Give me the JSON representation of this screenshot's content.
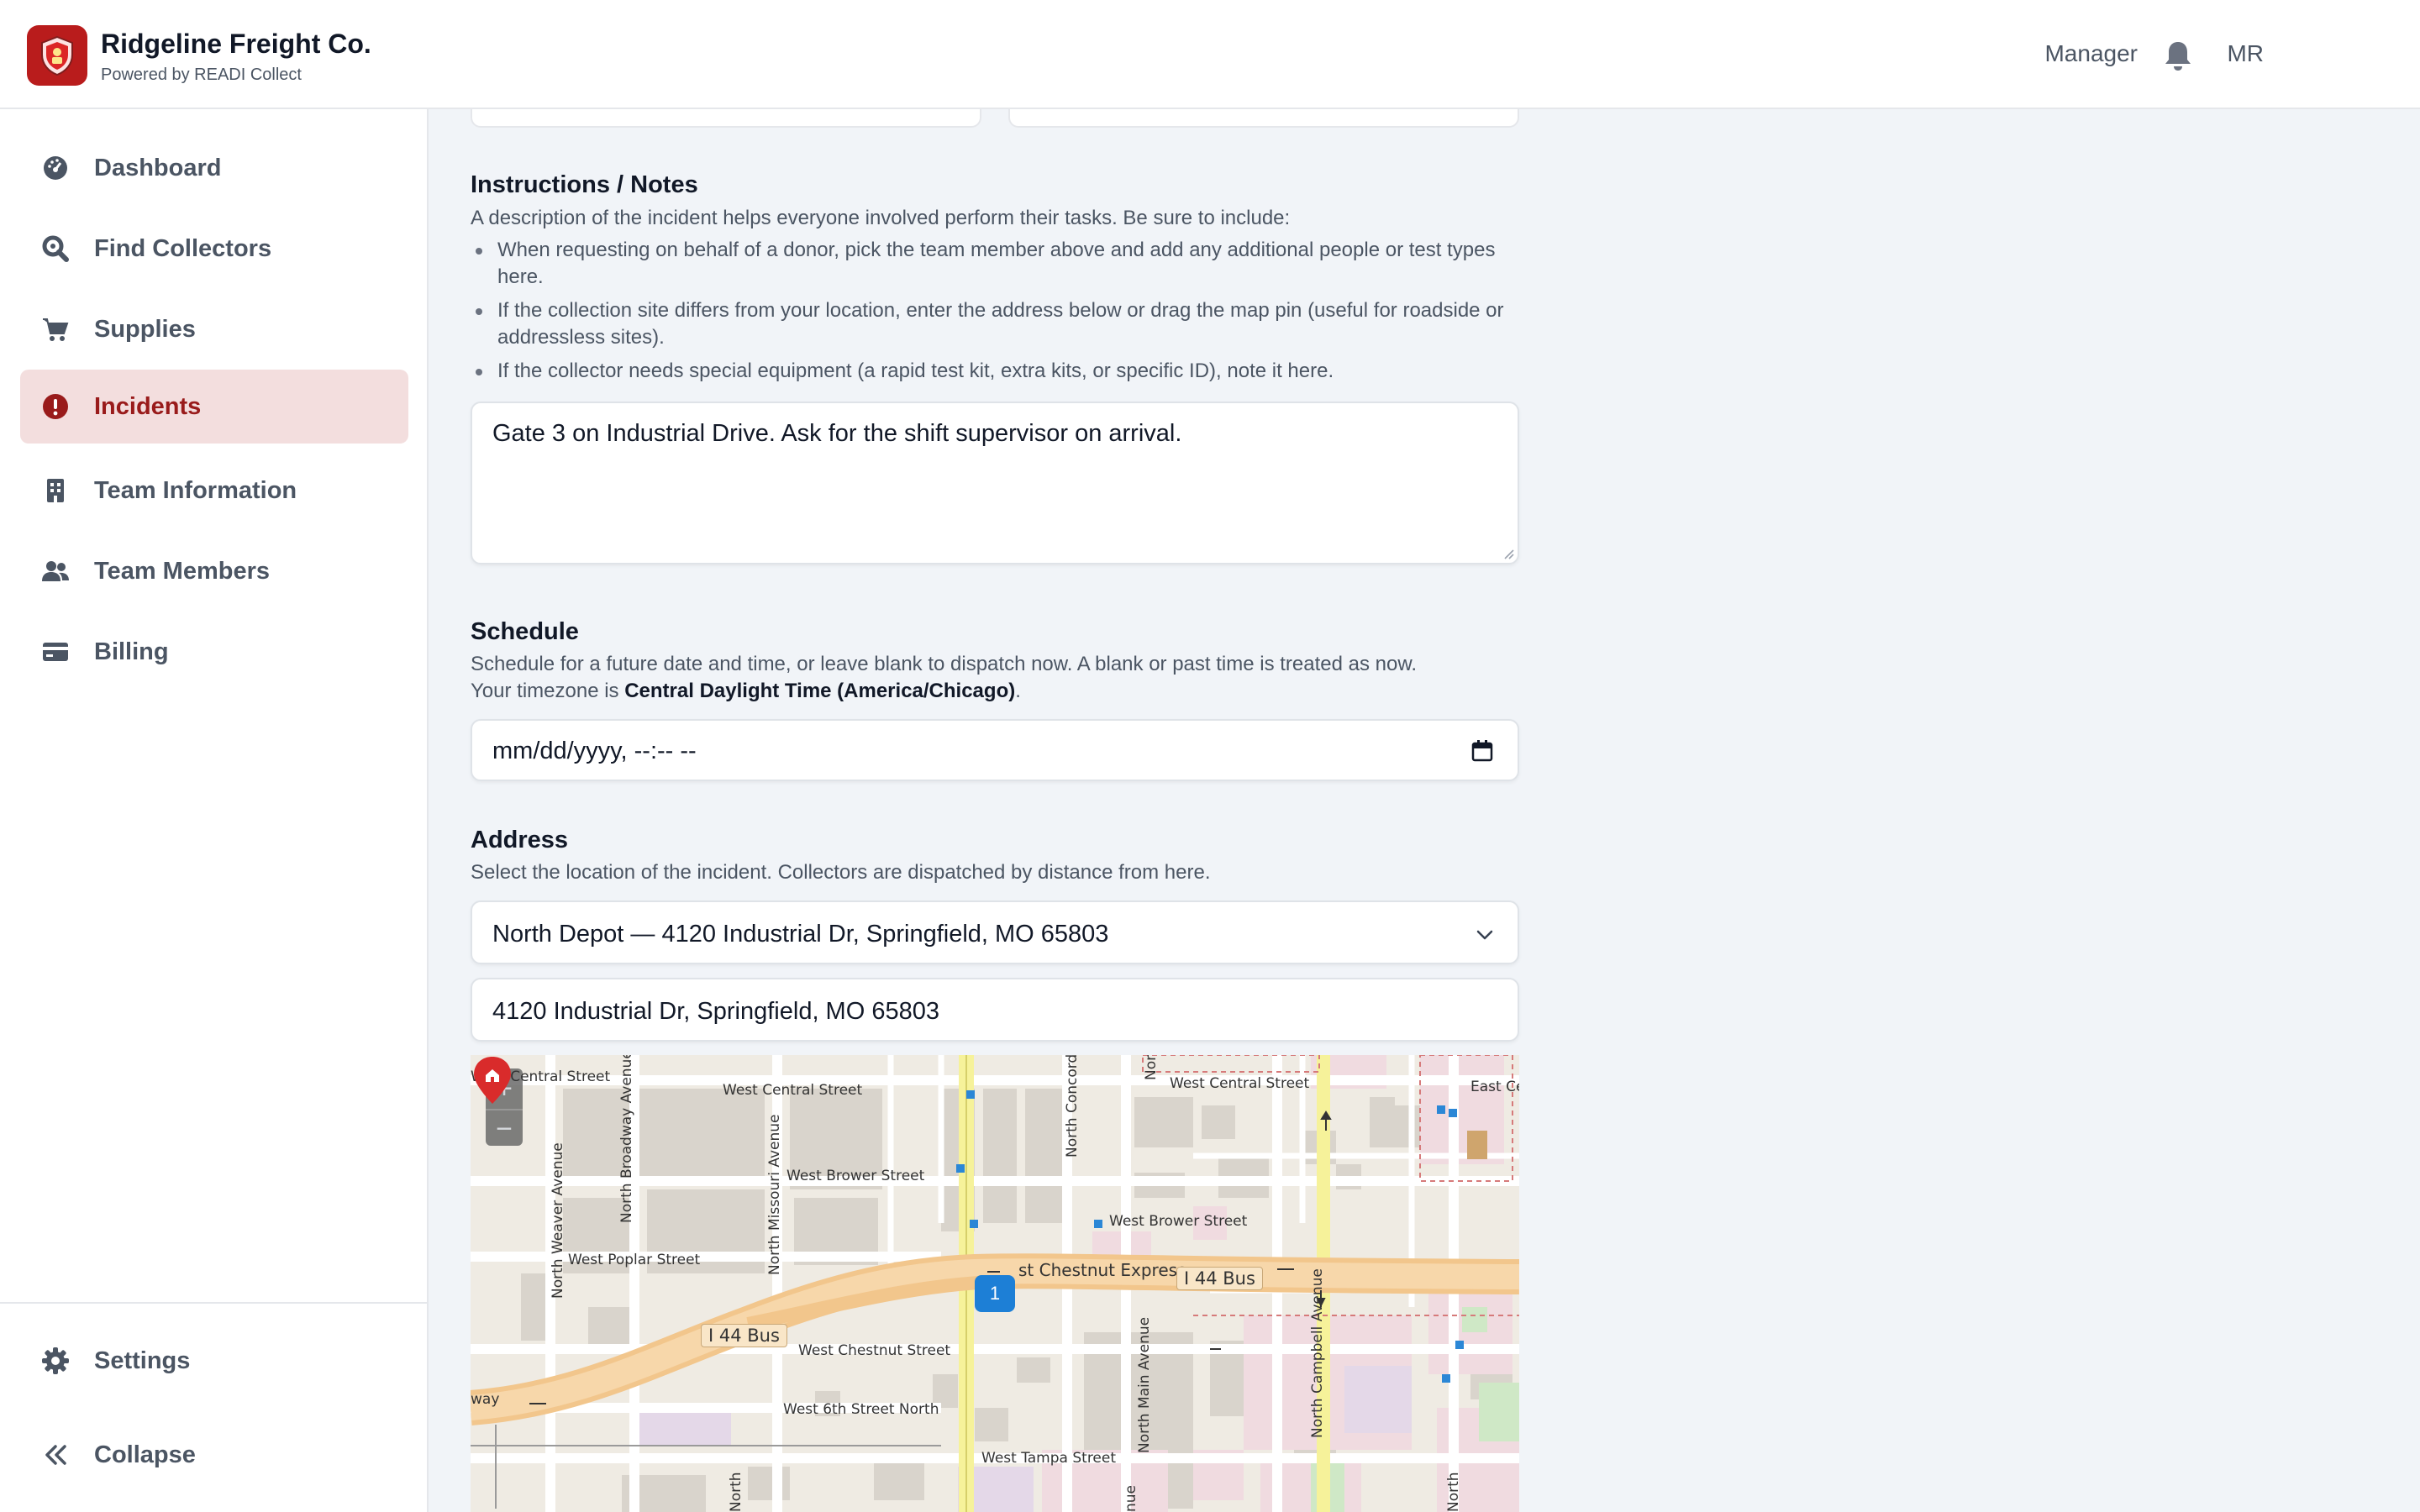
{
  "app": {
    "title": "Ridgeline Freight Co.",
    "subtitle": "Powered by READI Collect",
    "brand_color": "#b91c1c"
  },
  "header": {
    "role": "Manager",
    "bell_icon": "bell-icon",
    "user_initials": "MR"
  },
  "sidebar": {
    "items": [
      {
        "label": "Dashboard",
        "icon": "dashboard-icon",
        "active": false
      },
      {
        "label": "Find Collectors",
        "icon": "search-icon",
        "active": false
      },
      {
        "label": "Supplies",
        "icon": "cart-icon",
        "active": false
      },
      {
        "label": "Incidents",
        "icon": "alert-icon",
        "active": true
      },
      {
        "label": "Team Information",
        "icon": "building-icon",
        "active": false
      },
      {
        "label": "Team Members",
        "icon": "users-icon",
        "active": false
      },
      {
        "label": "Billing",
        "icon": "credit-card-icon",
        "active": false
      }
    ],
    "settings_label": "Settings",
    "collapse_label": "Collapse",
    "active_color": "#991b1b"
  },
  "notes": {
    "title": "Instructions / Notes",
    "description": "A description of the incident helps everyone involved perform their tasks. Be sure to include:",
    "bullets": [
      "When requesting on behalf of a donor, pick the team member above and add any additional people or test types here.",
      "If the collection site differs from your location, enter the address below or drag the map pin (useful for roadside or addressless sites).",
      "If the collector needs special equipment (a rapid test kit, extra kits, or specific ID), note it here."
    ],
    "value": "Gate 3 on Industrial Drive. Ask for the shift supervisor on arrival."
  },
  "schedule": {
    "title": "Schedule",
    "description": "Schedule for a future date and time, or leave blank to dispatch now. A blank or past time is treated as now.",
    "timezone_prefix": "Your timezone is",
    "timezone": "Central Daylight Time (America/Chicago)",
    "timezone_suffix": ".",
    "placeholder": "mm/dd/yyyy, --:-- --"
  },
  "address": {
    "title": "Address",
    "description": "Select the location of the incident. Collectors are dispatched by distance from here.",
    "selected": "North Depot — 4120 Industrial Dr, Springfield, MO 65803",
    "value": "4120 Industrial Dr, Springfield, MO 65803"
  },
  "map": {
    "zoom_in": "+",
    "zoom_out": "−",
    "marker_count": "1",
    "streets": {
      "central_w_left": "West Central Street",
      "central_w": "West Central Street",
      "central_w_right": "West Central Street",
      "central_e": "East Ce",
      "brower_w": "West Brower Street",
      "brower_w_right": "West Brower Street",
      "poplar_w": "West Poplar Street",
      "chestnut_expwy": "st Chestnut Expressw",
      "chestnut_w": "West Chestnut Street",
      "sixth_w": "West 6th Street North",
      "tampa_w": "West Tampa Street",
      "weaver_n": "North Weaver Avenue",
      "broadway_n": "North Broadway Avenue",
      "missouri_n": "North Missouri Avenue",
      "concord_n": "North Concord",
      "main_n": "North Main Avenue",
      "campbell_n": "North Campbell Avenue",
      "way": "way",
      "nor": "Nor",
      "north_bottom": "North",
      "nue": "nue"
    },
    "shields": {
      "bus_a": "I 44 Bus",
      "bus_b": "I 44 Bus"
    }
  }
}
